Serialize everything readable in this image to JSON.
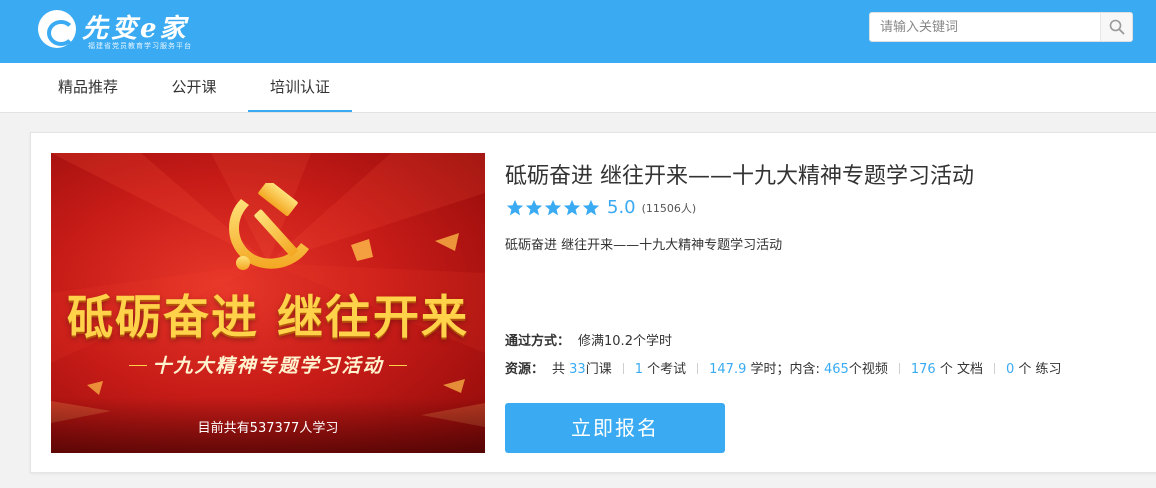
{
  "header": {
    "logo_text": "先变e家",
    "logo_subtitle": "福建省党员教育学习服务平台",
    "search": {
      "placeholder": "请输入关键词",
      "value": ""
    },
    "colors": {
      "bar": "#3aabf2"
    }
  },
  "nav": {
    "items": [
      {
        "label": "精品推荐",
        "active": false
      },
      {
        "label": "公开课",
        "active": false
      },
      {
        "label": "培训认证",
        "active": true
      }
    ]
  },
  "course": {
    "cover": {
      "title": "砥砺奋进  继往开来",
      "subtitle": "十九大精神专题学习活动",
      "learner_prefix": "目前共有",
      "learner_count": "537377",
      "learner_suffix": "人学习"
    },
    "title": "砥砺奋进  继往开来——十九大精神专题学习活动",
    "rating": {
      "stars": 5,
      "score": "5.0",
      "raters": "(11506人)"
    },
    "description": "砥砺奋进 继往开来——十九大精神专题学习活动",
    "pass": {
      "label": "通过方式：",
      "value": "修满10.2个学时"
    },
    "resources": {
      "label": "资源：",
      "courses_prefix": "共 ",
      "courses": "33",
      "courses_suffix": "门课",
      "exams": "1",
      "exams_suffix": " 个考试",
      "hours": "147.9",
      "hours_suffix": " 学时；",
      "includes_prefix": "内含: ",
      "videos": "465",
      "videos_suffix": "个视频",
      "docs": "176",
      "docs_suffix": " 个 文档",
      "exercises": "0",
      "exercises_suffix": " 个 练习"
    },
    "enroll_label": "立即报名"
  },
  "icons": {
    "search": "search-icon",
    "star": "star-icon",
    "emblem": "hammer-sickle-icon"
  }
}
